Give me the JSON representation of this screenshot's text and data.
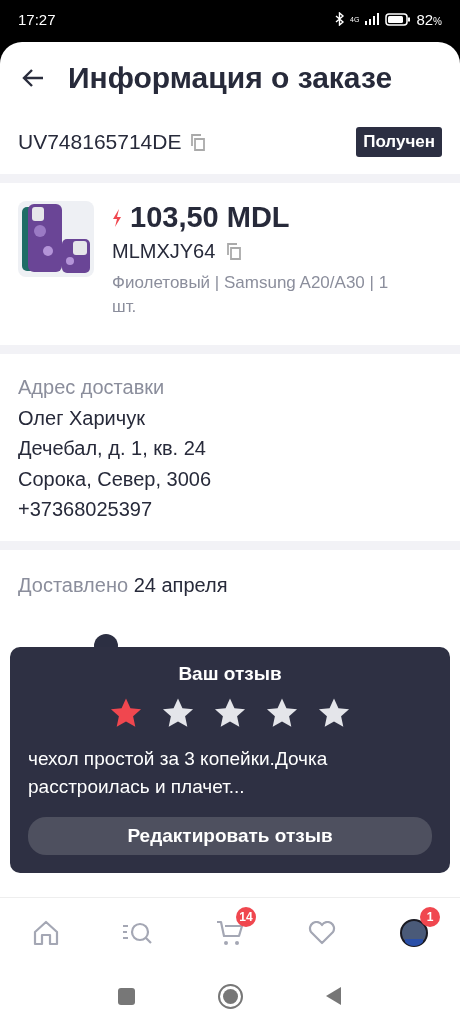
{
  "status_bar": {
    "time": "17:27",
    "network": "4G",
    "battery": "82",
    "battery_unit": "%"
  },
  "header": {
    "title": "Информация о заказе"
  },
  "order": {
    "number": "UV748165714DE",
    "status": "Получен"
  },
  "product": {
    "price": "103,50 MDL",
    "sku": "MLMXJY64",
    "variant": "Фиолетовый | Samsung A20/A30 | 1 шт."
  },
  "address": {
    "label": "Адрес доставки",
    "lines": [
      "Олег Харичук",
      "Дечебал, д. 1, кв. 24",
      "Сорока, Север, 3006",
      "+37368025397"
    ]
  },
  "delivery": {
    "label": "Доставлено",
    "date": "24 апреля"
  },
  "review": {
    "title": "Ваш отзыв",
    "stars": 1,
    "text": "чехол простой за 3 копейки.Дочка расстроилась и плачет...",
    "button": "Редактировать отзыв"
  },
  "bottom_nav": [
    {
      "kind": "home"
    },
    {
      "kind": "catalog"
    },
    {
      "kind": "cart",
      "badge": "14"
    },
    {
      "kind": "favorites"
    },
    {
      "kind": "profile",
      "badge": "1"
    }
  ]
}
